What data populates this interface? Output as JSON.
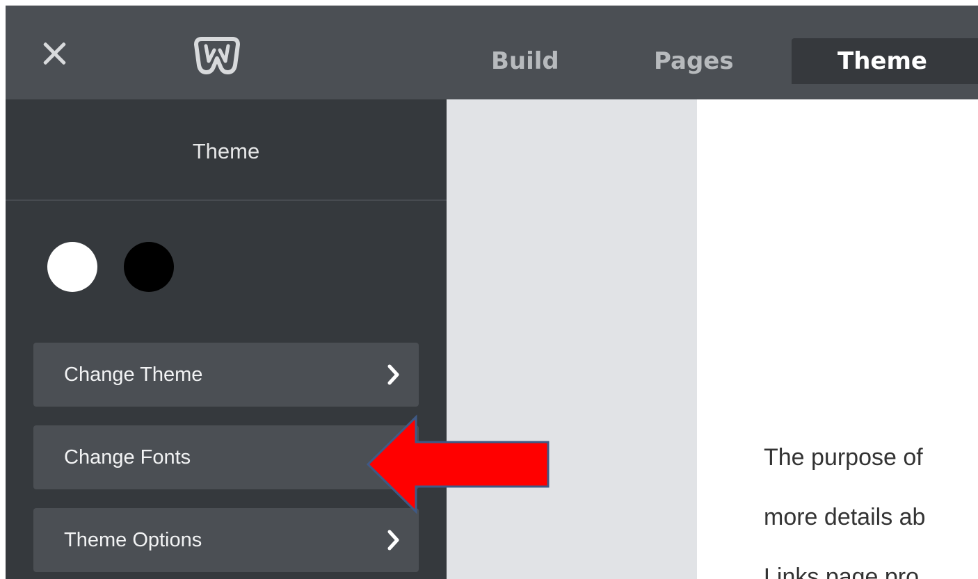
{
  "topbar": {
    "logo": "weebly-logo-icon",
    "tabs": [
      {
        "label": "Build",
        "active": false
      },
      {
        "label": "Pages",
        "active": false
      },
      {
        "label": "Theme",
        "active": true
      }
    ]
  },
  "sidebar": {
    "title": "Theme",
    "swatches": [
      {
        "name": "white",
        "color": "#ffffff"
      },
      {
        "name": "black",
        "color": "#000000"
      }
    ],
    "items": [
      {
        "label": "Change Theme",
        "has_chevron": true
      },
      {
        "label": "Change Fonts",
        "has_chevron": false
      },
      {
        "label": "Theme Options",
        "has_chevron": true
      }
    ]
  },
  "page_content": {
    "lines": [
      "The purpose of",
      "more details ab",
      "Links page pro"
    ]
  },
  "annotation": {
    "type": "arrow",
    "direction": "left",
    "fill": "#ff0000",
    "stroke": "#3f5a86",
    "points_to": "Change Fonts"
  },
  "colors": {
    "topbar": "#4b4f54",
    "sidebar": "#35393d",
    "menu_item": "#4b4f54",
    "editor_gutter": "#e1e3e6"
  }
}
